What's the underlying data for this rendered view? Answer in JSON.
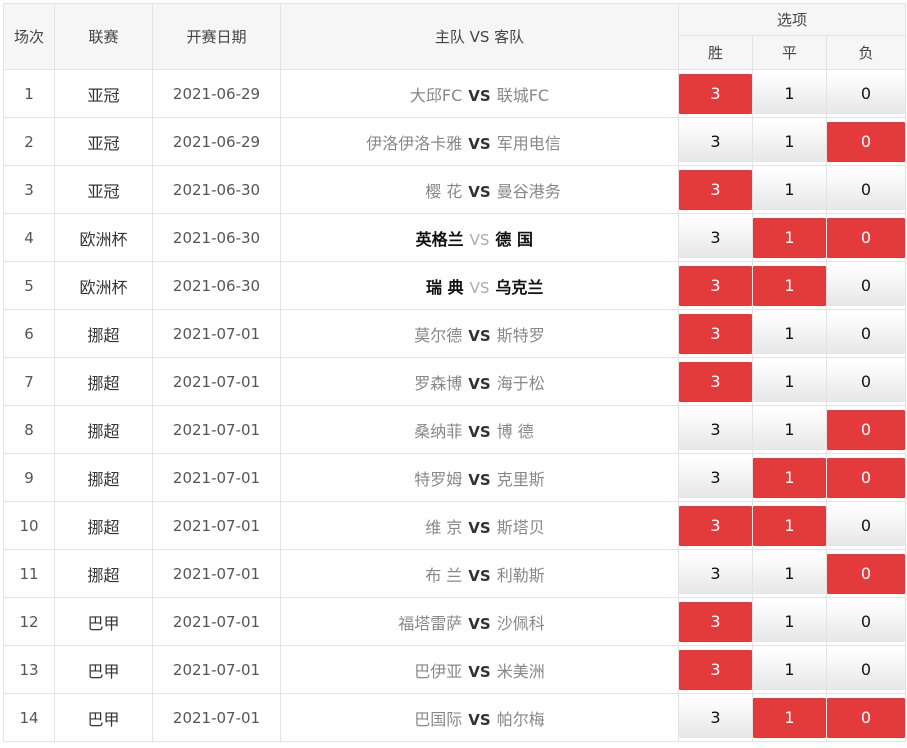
{
  "header": {
    "idx": "场次",
    "league": "联赛",
    "date": "开赛日期",
    "match": "主队 VS 客队",
    "options": "选项",
    "win": "胜",
    "draw": "平",
    "lose": "负"
  },
  "vs_label": "VS",
  "selected_color": "#e33a3c",
  "rows": [
    {
      "idx": "1",
      "league": "亚冠",
      "date": "2021-06-29",
      "home": "大邱FC",
      "away": "联城FC",
      "w": "3",
      "d": "1",
      "l": "0",
      "sel": [
        "w"
      ],
      "bold": false
    },
    {
      "idx": "2",
      "league": "亚冠",
      "date": "2021-06-29",
      "home": "伊洛伊洛卡雅",
      "away": "军用电信",
      "w": "3",
      "d": "1",
      "l": "0",
      "sel": [
        "l"
      ],
      "bold": false
    },
    {
      "idx": "3",
      "league": "亚冠",
      "date": "2021-06-30",
      "home": "樱 花",
      "away": "曼谷港务",
      "w": "3",
      "d": "1",
      "l": "0",
      "sel": [
        "w"
      ],
      "bold": false
    },
    {
      "idx": "4",
      "league": "欧洲杯",
      "date": "2021-06-30",
      "home": "英格兰",
      "away": "德 国",
      "w": "3",
      "d": "1",
      "l": "0",
      "sel": [
        "d",
        "l"
      ],
      "bold": true
    },
    {
      "idx": "5",
      "league": "欧洲杯",
      "date": "2021-06-30",
      "home": "瑞 典",
      "away": "乌克兰",
      "w": "3",
      "d": "1",
      "l": "0",
      "sel": [
        "w",
        "d"
      ],
      "bold": true
    },
    {
      "idx": "6",
      "league": "挪超",
      "date": "2021-07-01",
      "home": "莫尔德",
      "away": "斯特罗",
      "w": "3",
      "d": "1",
      "l": "0",
      "sel": [
        "w"
      ],
      "bold": false
    },
    {
      "idx": "7",
      "league": "挪超",
      "date": "2021-07-01",
      "home": "罗森博",
      "away": "海于松",
      "w": "3",
      "d": "1",
      "l": "0",
      "sel": [
        "w"
      ],
      "bold": false
    },
    {
      "idx": "8",
      "league": "挪超",
      "date": "2021-07-01",
      "home": "桑纳菲",
      "away": "博 德",
      "w": "3",
      "d": "1",
      "l": "0",
      "sel": [
        "l"
      ],
      "bold": false
    },
    {
      "idx": "9",
      "league": "挪超",
      "date": "2021-07-01",
      "home": "特罗姆",
      "away": "克里斯",
      "w": "3",
      "d": "1",
      "l": "0",
      "sel": [
        "d",
        "l"
      ],
      "bold": false
    },
    {
      "idx": "10",
      "league": "挪超",
      "date": "2021-07-01",
      "home": "维 京",
      "away": "斯塔贝",
      "w": "3",
      "d": "1",
      "l": "0",
      "sel": [
        "w",
        "d"
      ],
      "bold": false
    },
    {
      "idx": "11",
      "league": "挪超",
      "date": "2021-07-01",
      "home": "布 兰",
      "away": "利勒斯",
      "w": "3",
      "d": "1",
      "l": "0",
      "sel": [
        "l"
      ],
      "bold": false
    },
    {
      "idx": "12",
      "league": "巴甲",
      "date": "2021-07-01",
      "home": "福塔雷萨",
      "away": "沙佩科",
      "w": "3",
      "d": "1",
      "l": "0",
      "sel": [
        "w"
      ],
      "bold": false
    },
    {
      "idx": "13",
      "league": "巴甲",
      "date": "2021-07-01",
      "home": "巴伊亚",
      "away": "米美洲",
      "w": "3",
      "d": "1",
      "l": "0",
      "sel": [
        "w"
      ],
      "bold": false
    },
    {
      "idx": "14",
      "league": "巴甲",
      "date": "2021-07-01",
      "home": "巴国际",
      "away": "帕尔梅",
      "w": "3",
      "d": "1",
      "l": "0",
      "sel": [
        "d",
        "l"
      ],
      "bold": false
    }
  ]
}
